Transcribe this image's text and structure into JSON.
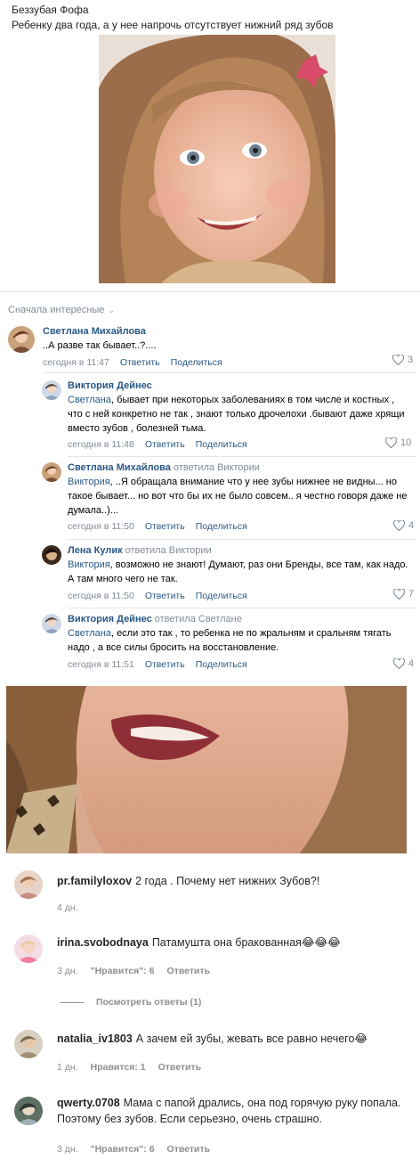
{
  "post": {
    "author": "Беззубая Фофа",
    "text": "Ребенку два года, а у нее напрочь отсутствует нижний ряд зубов"
  },
  "sort_label": "Сначала интересные",
  "labels": {
    "reply": "Ответить",
    "share": "Поделиться"
  },
  "comments": [
    {
      "name": "Светлана Михайлова",
      "reply_to": "",
      "text": "..А разве так бывает..?....",
      "addressee": "",
      "time": "сегодня в 11:47",
      "likes": "3"
    },
    {
      "name": "Виктория Дейнес",
      "reply_to": "",
      "addressee": "Светлана",
      "text": ", бывает при некоторых заболеваниях в том числе и костных , что с ней конкретно не так , знают только дрочелохи .бывают даже хрящи вместо зубов , болезней тьма.",
      "time": "сегодня в 11:48",
      "likes": "10"
    },
    {
      "name": "Светлана Михайлова",
      "reply_to": "ответила Виктории",
      "addressee": "Виктория",
      "text": ", ..Я обращала внимание что у нее зубы нижнее не видны... но такое бывает... но вот что бы их не было совсем.. я честно говоря даже не думала..)...",
      "time": "сегодня в 11:50",
      "likes": "4"
    },
    {
      "name": "Лена Кулик",
      "reply_to": "ответила Виктории",
      "addressee": "Виктория",
      "text": ", возможно не знают! Думают, раз они Бренды, все там, как надо. А там много чего не так.",
      "time": "сегодня в 11:50",
      "likes": "7"
    },
    {
      "name": "Виктория Дейнес",
      "reply_to": "ответила Светлане",
      "addressee": "Светлана",
      "text": ", если это так , то ребенка не по жральням и сральням тягать надо , а все силы бросить на восстановление.",
      "time": "сегодня в 11:51",
      "likes": "4"
    }
  ],
  "ig_comments": [
    {
      "user": "pr.familyloxov",
      "text": "2 года . Почему нет нижних Зубов?!",
      "age": "4 дн.",
      "likes": "",
      "reply": ""
    },
    {
      "user": "irina.svobodnaya",
      "text": "Патамушта она бракованная😂😂😂",
      "age": "3 дн.",
      "likes": "\"Нравится\": 6",
      "reply": "Ответить"
    },
    {
      "user": "natalia_iv1803",
      "text": "А зачем ей зубы, жевать все равно нечего😂",
      "age": "1 дн.",
      "likes": "Нравится: 1",
      "reply": "Ответить"
    },
    {
      "user": "qwerty.0708",
      "text": "Мама с папой дрались, она под горячую руку попала. Поэтому без зубов. Если серьезно, очень страшно.",
      "age": "3 дн.",
      "likes": "\"Нравится\": 6",
      "reply": "Ответить"
    }
  ],
  "view_replies": "Посмотреть ответы (1)",
  "colors": {
    "link": "#2a5885",
    "muted": "#818c99",
    "ig_muted": "#8e8e8e"
  }
}
